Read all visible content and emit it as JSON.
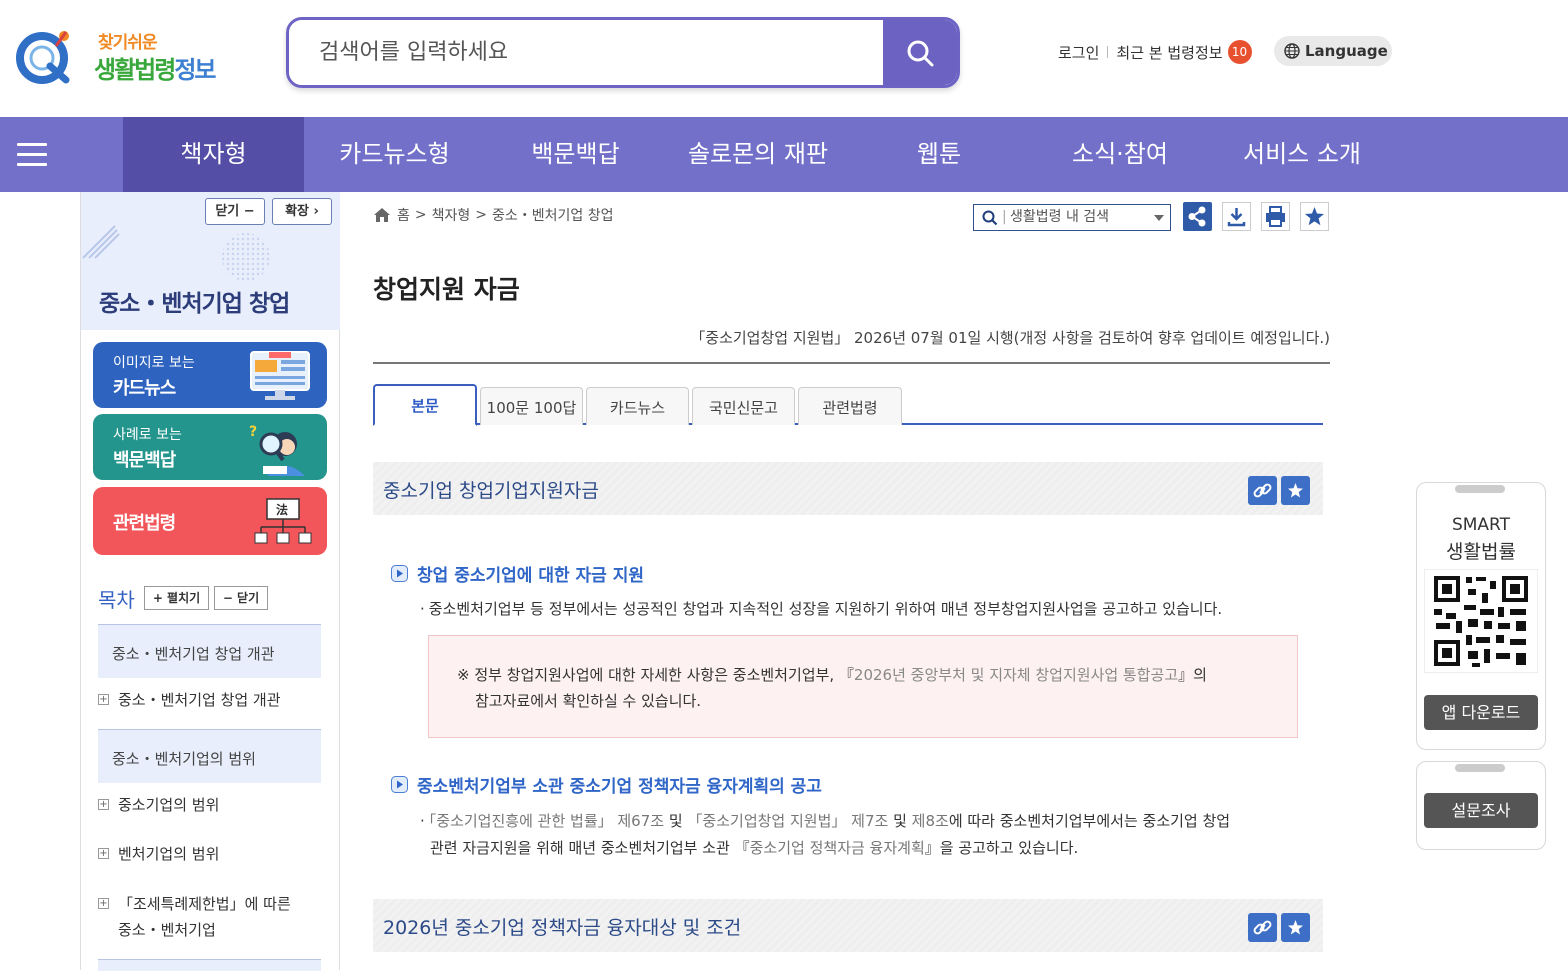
{
  "header": {
    "logo_top": "찾기쉬운",
    "logo_main_a": "생활법령",
    "logo_main_b": "정보",
    "search_placeholder": "검색어를 입력하세요",
    "login": "로그인",
    "recent": "최근 본 법령정보",
    "recent_count": "10",
    "language": "Language"
  },
  "nav": {
    "items": [
      "책자형",
      "카드뉴스형",
      "백문백답",
      "솔로몬의 재판",
      "웹툰",
      "소식·참여",
      "서비스 소개"
    ],
    "active": "책자형"
  },
  "sidebar": {
    "close_label": "닫기 −",
    "expand_label": "확장 ›",
    "title": "중소・벤처기업 창업",
    "cards": [
      {
        "small": "이미지로 보는",
        "big": "카드뉴스",
        "color": "#2e63c0"
      },
      {
        "small": "사례로 보는",
        "big": "백문백답",
        "color": "#23958c"
      },
      {
        "small": "",
        "big": "관련법령",
        "color": "#f2565a"
      }
    ],
    "toc_label": "목차",
    "toc_open": "+ 펼치기",
    "toc_close": "− 닫기",
    "toc": [
      {
        "type": "section",
        "text": "중소・벤처기업 창업 개관"
      },
      {
        "type": "item",
        "text": "중소・벤처기업 창업 개관"
      },
      {
        "type": "section",
        "text": "중소・벤처기업의 범위"
      },
      {
        "type": "item",
        "text": "중소기업의 범위"
      },
      {
        "type": "item",
        "text": "벤처기업의 범위"
      },
      {
        "type": "item",
        "text": "「조세특례제한법」에 따른 중소・벤처기업"
      }
    ]
  },
  "breadcrumb": {
    "home": "홈",
    "sep": ">",
    "level1": "책자형",
    "level2": "중소・벤처기업 창업"
  },
  "inner_search": {
    "placeholder": "생활법령 내 검색"
  },
  "page": {
    "title": "창업지원 자금",
    "info": "「중소기업창업 지원법」 2026년 07월 01일 시행(개정 사항을 검토하여 향후 업데이트 예정입니다.)"
  },
  "tabs": [
    "본문",
    "100문 100답",
    "카드뉴스",
    "국민신문고",
    "관련법령"
  ],
  "content": {
    "section1_title": "중소기업 창업기업지원자금",
    "sub1": "창업 중소기업에 대한 자금 지원",
    "para1": "중소벤처기업부 등 정부에서는 성공적인 창업과 지속적인 성장을 지원하기 위하여 매년 정부창업지원사업을 공고하고 있습니다.",
    "note_prefix": "※ 정부 창업지원사업에 대한 자세한 사항은 중소벤처기업부, 『",
    "note_link": "2026년 중앙부처 및 지자체 창업지원사업 통합공고",
    "note_suffix": "』의",
    "note_line2": "참고자료에서 확인하실 수 있습니다.",
    "sub2": "중소벤처기업부 소관 중소기업 정책자금 융자계획의 공고",
    "p2_link1": "「중소기업진흥에 관한 법률」 제67조",
    "p2_and1": " 및 ",
    "p2_link2": "「중소기업창업 지원법」 제7조",
    "p2_and2": " 및 ",
    "p2_link3": "제8조",
    "p2_text1": "에 따라 중소벤처기업부에서는 중소기업 창업",
    "p2_text2": "관련 자금지원을 위해 매년 중소벤처기업부 소관 『",
    "p2_link4": "중소기업 정책자금 융자계획",
    "p2_text3": "』을 공고하고 있습니다.",
    "section2_title": "2026년 중소기업 정책자금 융자대상 및 조건"
  },
  "widgets": {
    "app_title_1": "SMART",
    "app_title_2": "생활법률",
    "app_download": "앱 다운로드",
    "survey": "설문조사"
  },
  "colors": {
    "nav": "#7370c9",
    "nav_active": "#554ea7",
    "accent": "#2f66c7"
  }
}
